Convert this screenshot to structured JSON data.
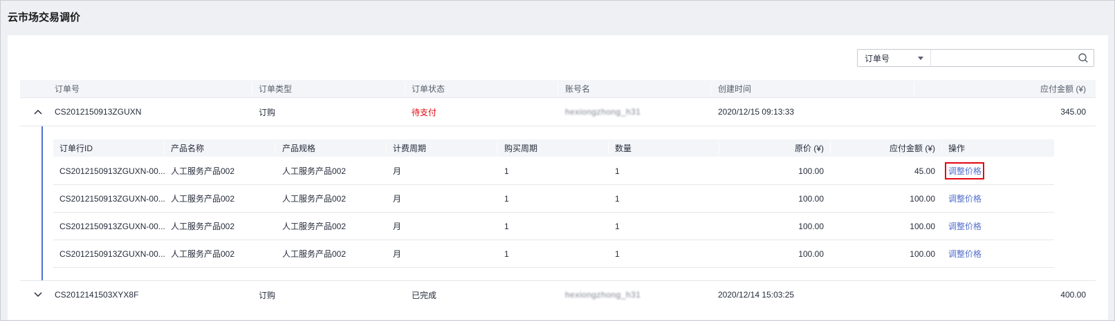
{
  "page": {
    "title": "云市场交易调价"
  },
  "search": {
    "field": "订单号",
    "placeholder": ""
  },
  "table": {
    "headers": [
      "订单号",
      "订单类型",
      "订单状态",
      "账号名",
      "创建时间",
      "应付金额 (¥)"
    ],
    "rows": [
      {
        "order_id": "CS2012150913ZGUXN",
        "type": "订购",
        "status": "待支付",
        "account": "hexiongzhong_h31",
        "created": "2020/12/15 09:13:33",
        "amount": "345.00",
        "expanded": true
      },
      {
        "order_id": "CS2012141503XYX8F",
        "type": "订购",
        "status": "已完成",
        "account": "hexiongzhong_h31",
        "created": "2020/12/14 15:03:25",
        "amount": "400.00",
        "expanded": false
      }
    ]
  },
  "sub_table": {
    "headers": [
      "订单行ID",
      "产品名称",
      "产品规格",
      "计费周期",
      "购买周期",
      "数量",
      "原价 (¥)",
      "应付金额 (¥)",
      "操作"
    ],
    "rows": [
      {
        "line_id": "CS2012150913ZGUXN-00...",
        "product": "人工服务产品002",
        "spec": "人工服务产品002",
        "billing": "月",
        "period": "1",
        "qty": "1",
        "original": "100.00",
        "payable": "45.00",
        "action": "调整价格"
      },
      {
        "line_id": "CS2012150913ZGUXN-00...",
        "product": "人工服务产品002",
        "spec": "人工服务产品002",
        "billing": "月",
        "period": "1",
        "qty": "1",
        "original": "100.00",
        "payable": "100.00",
        "action": "调整价格"
      },
      {
        "line_id": "CS2012150913ZGUXN-00...",
        "product": "人工服务产品002",
        "spec": "人工服务产品002",
        "billing": "月",
        "period": "1",
        "qty": "1",
        "original": "100.00",
        "payable": "100.00",
        "action": "调整价格"
      },
      {
        "line_id": "CS2012150913ZGUXN-00...",
        "product": "人工服务产品002",
        "spec": "人工服务产品002",
        "billing": "月",
        "period": "1",
        "qty": "1",
        "original": "100.00",
        "payable": "100.00",
        "action": "调整价格"
      }
    ]
  },
  "colors": {
    "accent": "#526ecc",
    "pending": "#e3060f",
    "header_bg": "#f3f5f8"
  },
  "icons": {
    "expanded": "chevron-up-icon",
    "collapsed": "chevron-down-icon",
    "search": "search-icon",
    "dropdown": "caret-down-icon"
  }
}
